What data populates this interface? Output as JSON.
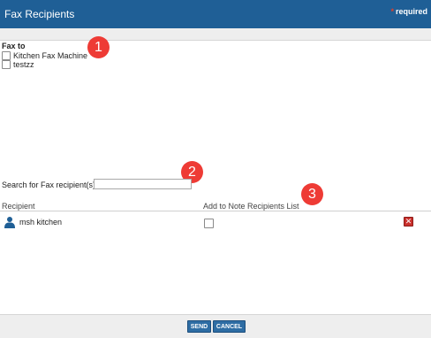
{
  "dialog": {
    "title": "Fax Recipients",
    "required_star": "*",
    "required_label": "required"
  },
  "fax_to": {
    "label": "Fax to",
    "options": [
      {
        "label": "Kitchen Fax Machine",
        "checked": false
      },
      {
        "label": "testzz",
        "checked": false
      }
    ]
  },
  "search": {
    "label": "Search for Fax recipient(s):",
    "value": "",
    "placeholder": ""
  },
  "table": {
    "headers": [
      "Recipient",
      "Add to Note Recipients List"
    ],
    "rows": [
      {
        "recipient": "msh kitchen",
        "add_to_list": false
      }
    ]
  },
  "callouts": [
    "1",
    "2",
    "3"
  ],
  "buttons": {
    "send": "SEND",
    "cancel": "CANCEL"
  },
  "icons": {
    "person": "person-icon",
    "remove": "remove-icon"
  },
  "colors": {
    "titlebar": "#1f5f96",
    "button": "#2e6da4",
    "callout": "#ee3b35",
    "remove": "#c9302c",
    "person_icon": "#1f5f96"
  }
}
